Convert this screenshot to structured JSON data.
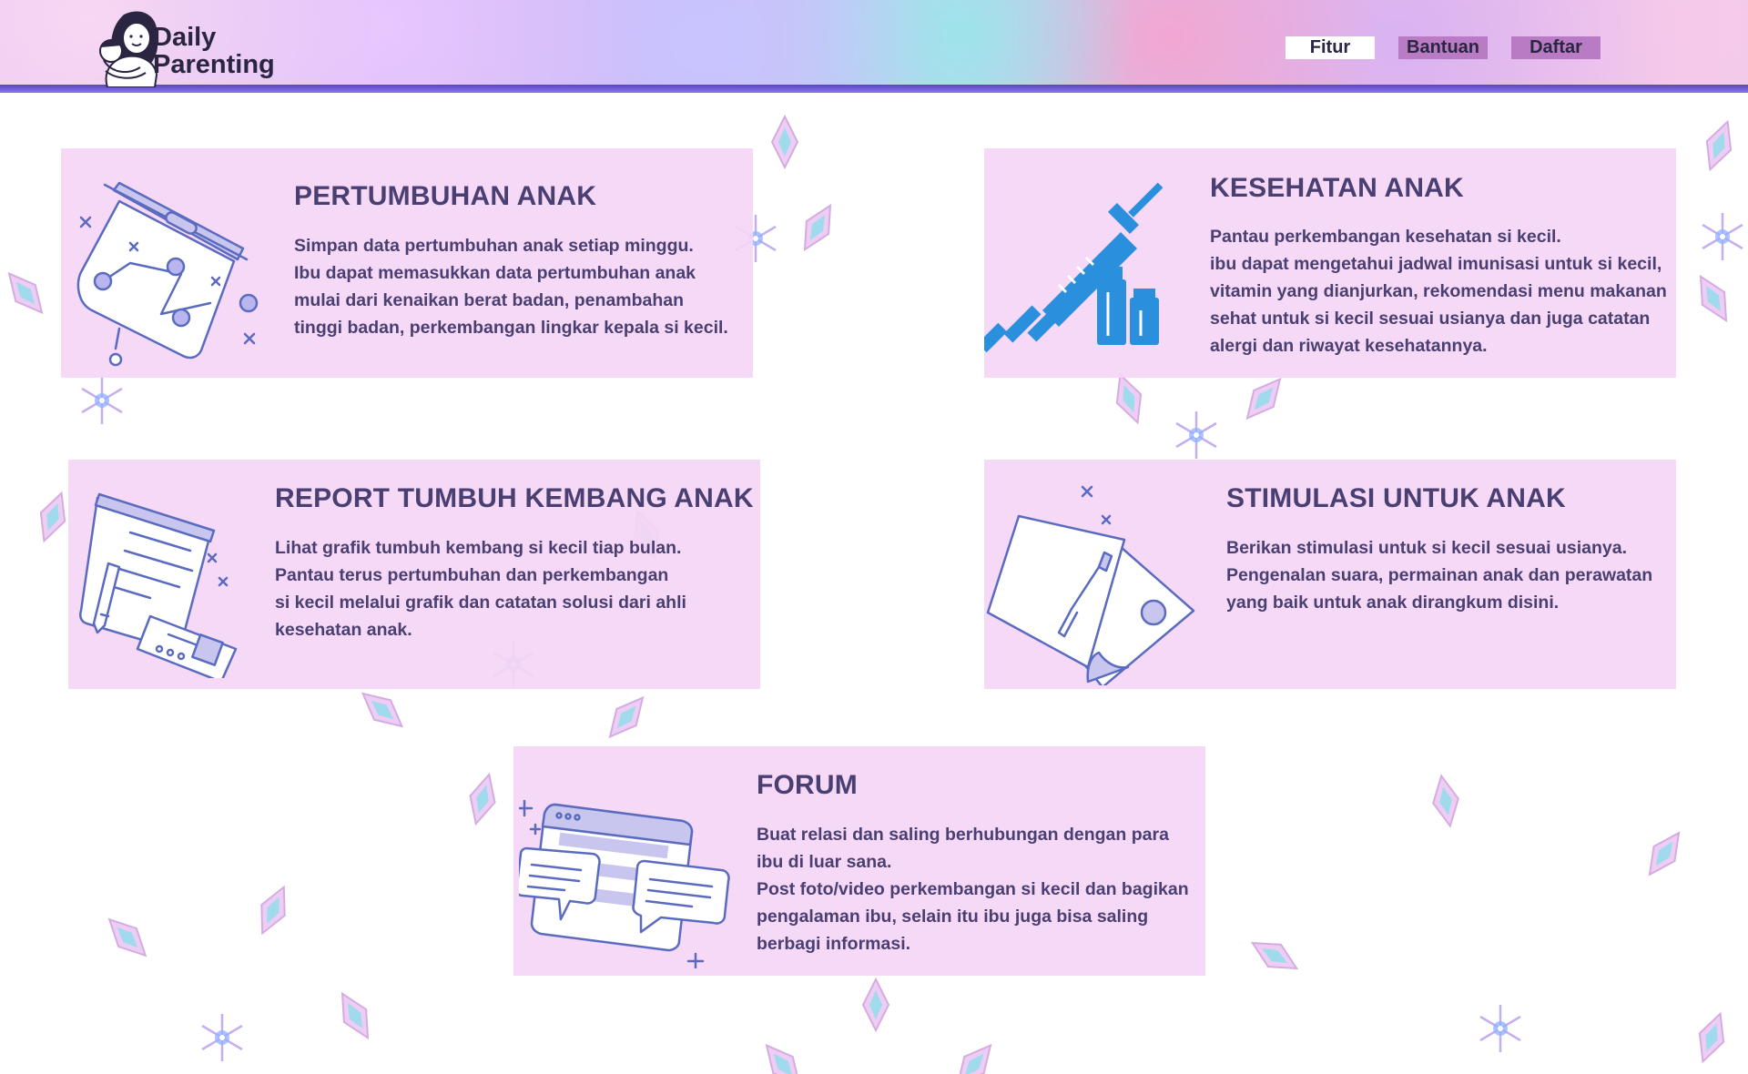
{
  "brand": {
    "line1": "Daily",
    "line2": "Parenting"
  },
  "nav": {
    "fitur": "Fitur",
    "bantuan": "Bantuan",
    "daftar": "Daftar"
  },
  "features": {
    "pertumbuhan": {
      "title": "PERTUMBUHAN ANAK",
      "lines": [
        "Simpan data pertumbuhan anak setiap minggu.",
        "Ibu dapat memasukkan data pertumbuhan anak",
        "mulai dari kenaikan berat badan, penambahan",
        "tinggi badan, perkembangan lingkar kepala si kecil."
      ],
      "icon": "growth-chart-board-icon"
    },
    "kesehatan": {
      "title": "KESEHATAN ANAK",
      "lines": [
        "Pantau perkembangan kesehatan si kecil.",
        "ibu dapat mengetahui jadwal imunisasi untuk si kecil,",
        "vitamin yang dianjurkan, rekomendasi menu makanan",
        "sehat untuk si kecil sesuai usianya dan juga catatan",
        "alergi dan riwayat kesehatannya."
      ],
      "icon": "syringe-icon"
    },
    "report": {
      "title": "REPORT TUMBUH KEMBANG ANAK",
      "lines": [
        "Lihat grafik tumbuh kembang si kecil tiap bulan.",
        "Pantau terus pertumbuhan dan perkembangan",
        "si kecil melalui grafik dan catatan solusi dari ahli",
        "kesehatan anak."
      ],
      "icon": "report-document-icon"
    },
    "stimulasi": {
      "title": "STIMULASI UNTUK ANAK",
      "lines": [
        "Berikan stimulasi untuk si kecil sesuai usianya.",
        "Pengenalan suara, permainan anak dan perawatan",
        "yang baik untuk anak dirangkum disini."
      ],
      "icon": "paint-brush-canvas-icon"
    },
    "forum": {
      "title": "FORUM",
      "lines": [
        "Buat relasi dan saling berhubungan dengan para",
        "ibu di luar sana.",
        "Post foto/video perkembangan si kecil dan bagikan",
        "pengalaman ibu, selain itu ibu juga bisa saling",
        "berbagi informasi."
      ],
      "icon": "chat-bubbles-icon"
    }
  },
  "colors": {
    "card_bg": "#f5d6f5",
    "text": "#4a3f72",
    "icon_line": "#5a6bc0",
    "icon_fill": "#c8c6ee",
    "syringe": "#2a8fdc",
    "nav_active": "#ffffff",
    "nav_inactive": "#b97bc4",
    "header_rule": "#5a45c0"
  }
}
